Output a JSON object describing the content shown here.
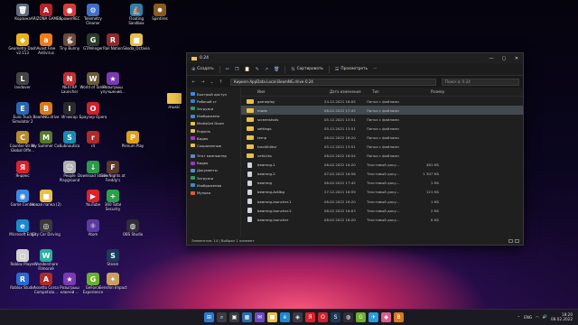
{
  "desktop": {
    "icons": [
      {
        "label": "Корзина",
        "glyph": "🗑",
        "color": "#5d6b7c"
      },
      {
        "label": "ARIZONA GAMES",
        "glyph": "A",
        "color": "#b4232a"
      },
      {
        "label": "ApowerREC",
        "glyph": "●",
        "color": "#d83a3a"
      },
      {
        "label": "Telemetry Cleaner",
        "glyph": "⚙",
        "color": "#3f6ec7"
      },
      {
        "label": "Floating Sandbox",
        "glyph": "⛵",
        "color": "#2f7fa8"
      },
      {
        "label": "Spintires",
        "glyph": "✸",
        "color": "#8a5a1c"
      },
      {
        "label": "Geometry Dash v2.113",
        "glyph": "◆",
        "color": "#e8b21c"
      },
      {
        "label": "Avast Free Antivirus",
        "glyph": "a",
        "color": "#f27a1a"
      },
      {
        "label": "Tiny Bunny",
        "glyph": "🐇",
        "color": "#6b4a3a"
      },
      {
        "label": "GTAVenger",
        "glyph": "G",
        "color": "#2e3a2a"
      },
      {
        "label": "Rail Nation",
        "glyph": "R",
        "color": "#8c2b2b"
      },
      {
        "label": "Skoda_Octavia",
        "glyph": "■",
        "color": "#e9bf48"
      },
      {
        "label": "landover",
        "glyph": "L",
        "color": "#444"
      },
      {
        "label": "NEXTRP Launcher",
        "glyph": "N",
        "color": "#c03030"
      },
      {
        "label": "World of Tanks",
        "glyph": "W",
        "color": "#6b5c3a"
      },
      {
        "label": "Розыгрыш улучшений...",
        "glyph": "★",
        "color": "#7a3ab0"
      },
      {
        "label": "Euro Truck Simulator 2",
        "glyph": "E",
        "color": "#2a66b0"
      },
      {
        "label": "BeamNG.drive",
        "glyph": "B",
        "color": "#d87a1a"
      },
      {
        "label": "Игнисар",
        "glyph": "I",
        "color": "#2a2a2a"
      },
      {
        "label": "Браузер Opera",
        "glyph": "O",
        "color": "#d0202e"
      },
      {
        "label": "Counter-Strike Global Offe...",
        "glyph": "C",
        "color": "#b58a2a"
      },
      {
        "label": "My Summer Car",
        "glyph": "M",
        "color": "#557a2a"
      },
      {
        "label": "Subnautica",
        "glyph": "S",
        "color": "#1a8ab0"
      },
      {
        "label": "r4",
        "glyph": "r",
        "color": "#b02a2a"
      },
      {
        "label": "Plenum Play",
        "glyph": "P",
        "color": "#e0a020"
      },
      {
        "label": "Яндекс",
        "glyph": "Я",
        "color": "#e0202a"
      },
      {
        "label": "People Playground",
        "glyph": "☺",
        "color": "#b0b0b0"
      },
      {
        "label": "Download Studio",
        "glyph": "↓",
        "color": "#2a9a4a"
      },
      {
        "label": "Five Nights at Freddy's",
        "glyph": "F",
        "color": "#5a3a2a"
      },
      {
        "label": "Game Center",
        "glyph": "◉",
        "color": "#3a8ae0"
      },
      {
        "label": "Новая папка (2)",
        "glyph": "■",
        "color": "#e9bf48"
      },
      {
        "label": "YouTube",
        "glyph": "▶",
        "color": "#e0202a"
      },
      {
        "label": "360 Total Security",
        "glyph": "+",
        "color": "#2aa04a"
      },
      {
        "label": "Microsoft Edge",
        "glyph": "e",
        "color": "#1a8ad0"
      },
      {
        "label": "City Car Driving",
        "glyph": "◎",
        "color": "#3a3a3a"
      },
      {
        "label": "Atom",
        "glyph": "⚛",
        "color": "#5a3aa0"
      },
      {
        "label": "OBS Studio",
        "glyph": "◍",
        "color": "#302c38"
      },
      {
        "label": "Roblox Player",
        "glyph": "◻",
        "color": "#d0d0d0"
      },
      {
        "label": "Wondershare Filmora9",
        "glyph": "W",
        "color": "#2ab0a0"
      },
      {
        "label": "Steam",
        "glyph": "S",
        "color": "#1b3a5a"
      },
      {
        "label": "Roblox Studio",
        "glyph": "R",
        "color": "#2a6ad0"
      },
      {
        "label": "Assetto Corsa Competizio...",
        "glyph": "A",
        "color": "#b02a2a"
      },
      {
        "label": "Розыгрыш ключей ...",
        "glyph": "★",
        "color": "#7a3ab0"
      },
      {
        "label": "GeForce Experience",
        "glyph": "G",
        "color": "#6ab02a"
      },
      {
        "label": "Genshin Impact",
        "glyph": "✦",
        "color": "#c8a060"
      }
    ],
    "folder_music_label": "music"
  },
  "explorer": {
    "title": "0.24",
    "window_buttons": [
      "—",
      "▢",
      "✕"
    ],
    "commands": {
      "create": "Создать",
      "sort": "Сортировать",
      "view": "Просмотреть",
      "more": "···"
    },
    "path": [
      "Кирилл",
      "AppData",
      "Local",
      "BeamNG.drive",
      "0.24"
    ],
    "path_separator": " › ",
    "search_placeholder": "Поиск в: 0.24",
    "columns": {
      "name": "Имя",
      "date": "Дата изменения",
      "type": "Тип",
      "size": "Размер"
    },
    "sidebar": [
      {
        "label": "Быстрый доступ",
        "color": "#3a8ae0"
      },
      {
        "label": "Рабочий ст",
        "color": "#3a7ad0"
      },
      {
        "label": "Загрузки",
        "color": "#2a9a6a"
      },
      {
        "label": "Изображени",
        "color": "#3a8ad0"
      },
      {
        "label": "MediaGet Down",
        "color": "#e9bf48"
      },
      {
        "label": "Projects",
        "color": "#e9bf48"
      },
      {
        "label": "Видео",
        "color": "#9a3ac0"
      },
      {
        "label": "Сохраненные",
        "color": "#e9bf48"
      },
      {
        "label": "Этот компьютер",
        "color": "#5a8ad0"
      },
      {
        "label": "Видео",
        "color": "#9a3ac0"
      },
      {
        "label": "Документы",
        "color": "#5a8ad0"
      },
      {
        "label": "Загрузки",
        "color": "#2a9a6a"
      },
      {
        "label": "Изображения",
        "color": "#3a8ad0"
      },
      {
        "label": "Музыка",
        "color": "#e05a3a"
      }
    ],
    "files": [
      {
        "name": "gameplay",
        "date": "24.12.2021 16:05",
        "type": "Папка с файлами",
        "size": "",
        "kind": "folder"
      },
      {
        "name": "mods",
        "date": "08.02.2022 17:45",
        "type": "Папка с файлами",
        "size": "",
        "kind": "folder",
        "selected": true
      },
      {
        "name": "screenshots",
        "date": "05.12.2021 13:51",
        "type": "Папка с файлами",
        "size": "",
        "kind": "folder"
      },
      {
        "name": "settings",
        "date": "05.12.2021 13:51",
        "type": "Папка с файлами",
        "size": "",
        "kind": "folder"
      },
      {
        "name": "temp",
        "date": "08.02.2022 18:20",
        "type": "Папка с файлами",
        "size": "",
        "kind": "folder"
      },
      {
        "name": "trackEditor",
        "date": "05.12.2021 13:51",
        "type": "Папка с файлами",
        "size": "",
        "kind": "folder"
      },
      {
        "name": "vehicles",
        "date": "08.02.2022 16:54",
        "type": "Папка с файлами",
        "size": "",
        "kind": "folder"
      },
      {
        "name": "beamng.1",
        "date": "08.02.2022 18:20",
        "type": "Текстовый доку...",
        "size": "481 КБ",
        "kind": "file"
      },
      {
        "name": "beamng.2",
        "date": "07.02.2022 16:56",
        "type": "Текстовый доку...",
        "size": "1 307 КБ",
        "kind": "file"
      },
      {
        "name": "beamng",
        "date": "08.02.2022 17:45",
        "type": "Текстовый доку...",
        "size": "1 КБ",
        "kind": "file"
      },
      {
        "name": "beamng-AvDbg",
        "date": "27.12.2021 16:59",
        "type": "Текстовый доку...",
        "size": "121 КБ",
        "kind": "file"
      },
      {
        "name": "beamng-launcher.1",
        "date": "08.02.2022 18:20",
        "type": "Текстовый доку...",
        "size": "1 КБ",
        "kind": "file"
      },
      {
        "name": "beamng-launcher.2",
        "date": "08.02.2022 16:03",
        "type": "Текстовый доку...",
        "size": "2 КБ",
        "kind": "file"
      },
      {
        "name": "beamng-launcher",
        "date": "08.02.2022 18:20",
        "type": "Текстовый доку...",
        "size": "0 КБ",
        "kind": "file"
      }
    ],
    "status": "Элементов: 14  |  Выбран 1 элемент"
  },
  "taskbar": {
    "icons": [
      {
        "name": "start",
        "glyph": "⊞",
        "color": "#2a7ad0"
      },
      {
        "name": "search",
        "glyph": "⌕",
        "color": "#3a3a44"
      },
      {
        "name": "task-view",
        "glyph": "▣",
        "color": "#3a3a44"
      },
      {
        "name": "widgets",
        "glyph": "▦",
        "color": "#2a6ab0"
      },
      {
        "name": "chat",
        "glyph": "✉",
        "color": "#6a4ac0"
      },
      {
        "name": "explorer",
        "glyph": "■",
        "color": "#e9bf48"
      },
      {
        "name": "edge",
        "glyph": "e",
        "color": "#1a8ad0"
      },
      {
        "name": "store",
        "glyph": "◈",
        "color": "#3a3a44"
      },
      {
        "name": "yandex",
        "glyph": "Я",
        "color": "#e0202a"
      },
      {
        "name": "opera",
        "glyph": "O",
        "color": "#d0202e"
      },
      {
        "name": "steam",
        "glyph": "S",
        "color": "#1b3a5a"
      },
      {
        "name": "obs",
        "glyph": "◍",
        "color": "#302c38"
      },
      {
        "name": "geforce",
        "glyph": "G",
        "color": "#6ab02a"
      },
      {
        "name": "telegram",
        "glyph": "✈",
        "color": "#2a9ae0"
      },
      {
        "name": "photos",
        "glyph": "◆",
        "color": "#e05a8a"
      },
      {
        "name": "beamng",
        "glyph": "B",
        "color": "#d87a1a"
      }
    ],
    "tray": {
      "lang": "ENG",
      "time": "18:20",
      "date": "08.02.2022"
    }
  }
}
